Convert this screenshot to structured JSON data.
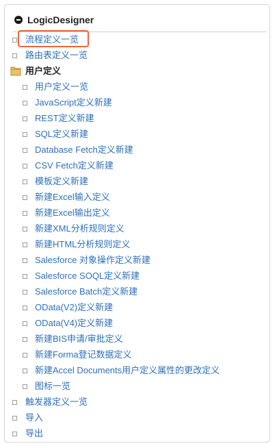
{
  "panel": {
    "title": "LogicDesigner"
  },
  "tree": {
    "top_items": [
      {
        "label": "流程定义一览"
      },
      {
        "label": "路由表定义一览"
      }
    ],
    "folder": {
      "label": "用户定义",
      "children": [
        "用户定义一览",
        "JavaScript定义新建",
        "REST定义新建",
        "SQL定义新建",
        "Database Fetch定义新建",
        "CSV Fetch定义新建",
        "模板定义新建",
        "新建Excel输入定义",
        "新建Excel输出定义",
        "新建XML分析规则定义",
        "新建HTML分析规则定义",
        "Salesforce 对象操作定义新建",
        "Salesforce SOQL定义新建",
        "Salesforce Batch定义新建",
        "OData(V2)定义新建",
        "OData(V4)定义新建",
        "新建BIS申请/审批定义",
        "新建Forma登记数据定义",
        "新建Accel Documents用户定义属性的更改定义",
        "图标一览"
      ]
    },
    "bottom_items": [
      {
        "label": "触发器定义一览"
      },
      {
        "label": "导入"
      },
      {
        "label": "导出"
      }
    ]
  },
  "colors": {
    "link": "#2e70b8",
    "highlight": "#e9663d",
    "border": "#d4d4d4"
  }
}
